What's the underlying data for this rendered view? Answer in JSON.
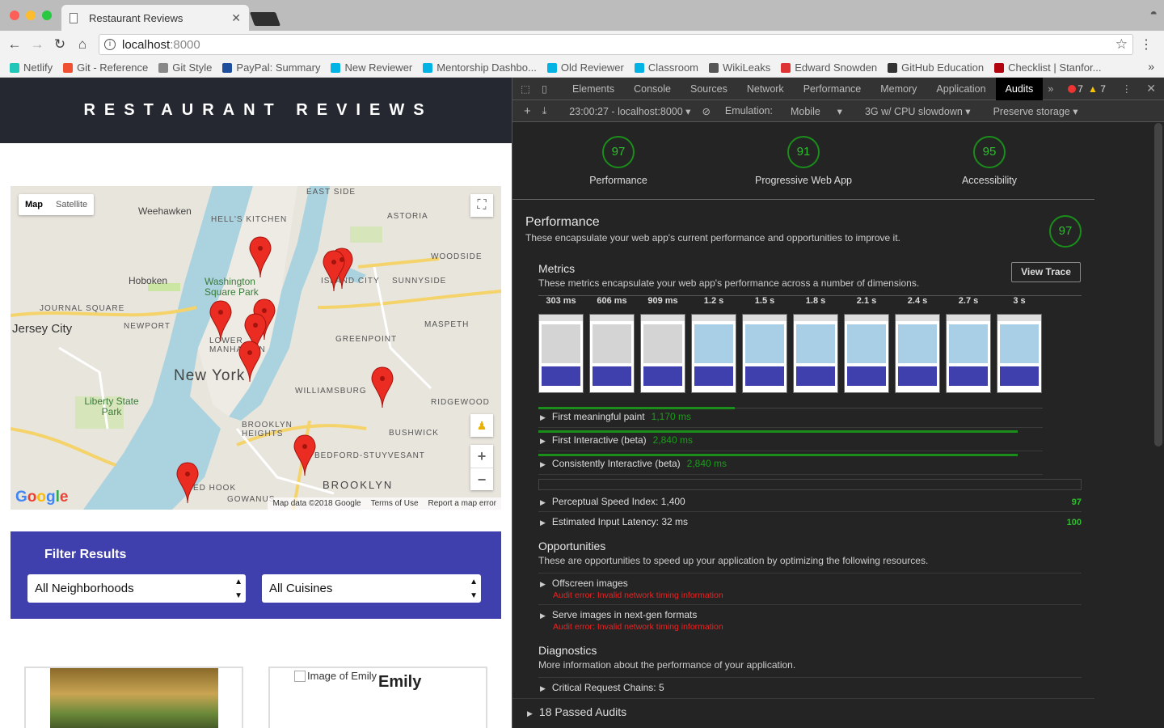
{
  "browser": {
    "tab_title": "Restaurant Reviews",
    "url_host": "localhost",
    "url_port": ":8000"
  },
  "bookmarks": [
    {
      "label": "Netlify",
      "color": "#20c6b7"
    },
    {
      "label": "Git - Reference",
      "color": "#f05032"
    },
    {
      "label": "Git Style",
      "color": "#888888"
    },
    {
      "label": "PayPal: Summary",
      "color": "#1f4f9c"
    },
    {
      "label": "New Reviewer",
      "color": "#02b3e4"
    },
    {
      "label": "Mentorship Dashbo...",
      "color": "#02b3e4"
    },
    {
      "label": "Old Reviewer",
      "color": "#02b3e4"
    },
    {
      "label": "Classroom",
      "color": "#02b3e4"
    },
    {
      "label": "WikiLeaks",
      "color": "#555555"
    },
    {
      "label": "Edward Snowden",
      "color": "#d33"
    },
    {
      "label": "GitHub Education",
      "color": "#333333"
    },
    {
      "label": "Checklist | Stanfor...",
      "color": "#b1040e"
    }
  ],
  "site": {
    "header": "RESTAURANT REVIEWS",
    "map": {
      "type_map": "Map",
      "type_satellite": "Satellite",
      "google": "Google",
      "attribution": "Map data ©2018 Google",
      "terms": "Terms of Use",
      "report": "Report a map error",
      "labels": {
        "weehawken": "Weehawken",
        "hells_kitchen": "HELL'S KITCHEN",
        "east_side": "EAST SIDE",
        "astoria": "ASTORIA",
        "hoboken": "Hoboken",
        "washington_sq": "Washington Square Park",
        "woodside": "WOODSIDE",
        "island_city": "ISLAND CITY",
        "sunnyside": "SUNNYSIDE",
        "journal_sq": "JOURNAL SQUARE",
        "jersey_city": "Jersey City",
        "newport": "NEWPORT",
        "maspeth": "MASPETH",
        "lower_manhattan": "LOWER MANHATTAN",
        "greenpoint": "GREENPOINT",
        "new_york": "New York",
        "williamsburg": "WILLIAMSBURG",
        "liberty": "Liberty State Park",
        "ridgewood": "RIDGEWOOD",
        "brooklyn_heights": "BROOKLYN HEIGHTS",
        "bushwick": "BUSHWICK",
        "bed_stuy": "BEDFORD-STUYVESANT",
        "brooklyn": "BROOKLYN",
        "red_hook": "ED HOOK",
        "gowanus": "GOWANUS"
      }
    },
    "filter": {
      "title": "Filter Results",
      "neighborhood": "All Neighborhoods",
      "cuisine": "All Cuisines"
    },
    "cards": {
      "alt_text": "Image of Emily",
      "name": "Emily"
    }
  },
  "devtools": {
    "tabs": [
      "Elements",
      "Console",
      "Sources",
      "Network",
      "Performance",
      "Memory",
      "Application",
      "Audits"
    ],
    "active_tab": "Audits",
    "errors": "7",
    "warnings": "7",
    "toolbar": {
      "session": "23:00:27 - localhost:8000",
      "emulation_label": "Emulation:",
      "emulation_value": "Mobile",
      "throttling": "3G w/ CPU slowdown",
      "storage": "Preserve storage"
    },
    "scores": [
      {
        "label": "Performance",
        "value": "97"
      },
      {
        "label": "Progressive Web App",
        "value": "91"
      },
      {
        "label": "Accessibility",
        "value": "95"
      }
    ],
    "performance": {
      "title": "Performance",
      "desc": "These encapsulate your web app's current performance and opportunities to improve it.",
      "score": "97"
    },
    "metrics": {
      "title": "Metrics",
      "desc": "These metrics encapsulate your web app's performance across a number of dimensions.",
      "view_trace": "View Trace",
      "filmstrip": [
        "303 ms",
        "606 ms",
        "909 ms",
        "1.2 s",
        "1.5 s",
        "1.8 s",
        "2.1 s",
        "2.4 s",
        "2.7 s",
        "3 s"
      ],
      "items": [
        {
          "label": "First meaningful paint",
          "value": "1,170 ms",
          "fraction": 0.39
        },
        {
          "label": "First Interactive (beta)",
          "value": "2,840 ms",
          "fraction": 0.95
        },
        {
          "label": "Consistently Interactive (beta)",
          "value": "2,840 ms",
          "fraction": 0.95
        }
      ],
      "psi": {
        "label": "Perceptual Speed Index: 1,400",
        "score": "97"
      },
      "eil": {
        "label": "Estimated Input Latency: 32 ms",
        "score": "100"
      }
    },
    "opportunities": {
      "title": "Opportunities",
      "desc": "These are opportunities to speed up your application by optimizing the following resources.",
      "items": [
        {
          "label": "Offscreen images",
          "error": "Audit error: Invalid network timing information"
        },
        {
          "label": "Serve images in next-gen formats",
          "error": "Audit error: Invalid network timing information"
        }
      ]
    },
    "diagnostics": {
      "title": "Diagnostics",
      "desc": "More information about the performance of your application.",
      "item": "Critical Request Chains: 5"
    },
    "passed": "18 Passed Audits"
  }
}
